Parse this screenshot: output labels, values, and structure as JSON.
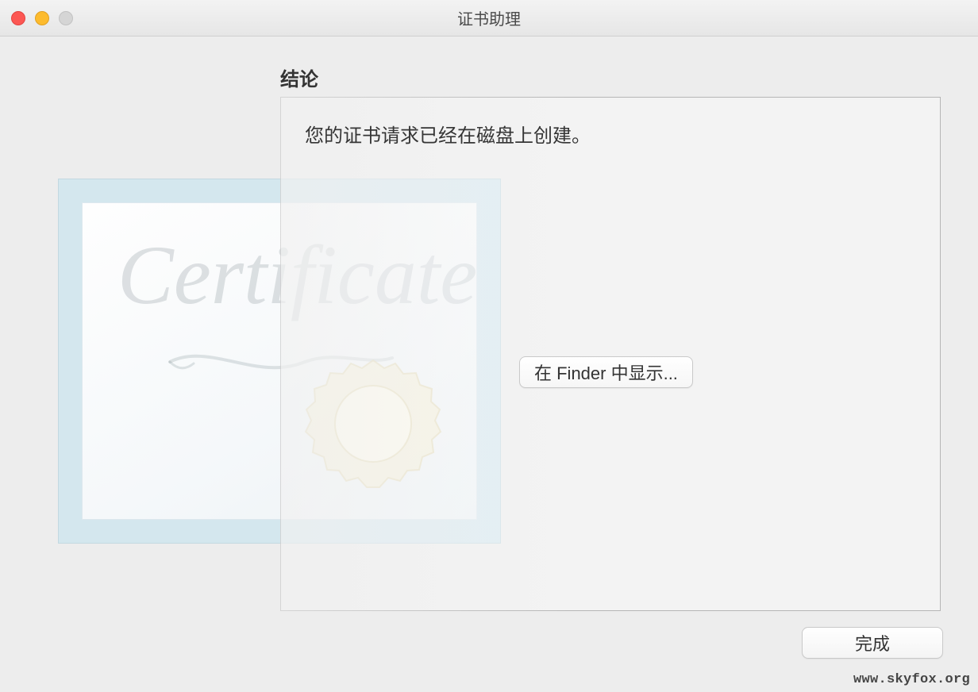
{
  "window": {
    "title": "证书助理"
  },
  "heading": "结论",
  "message": "您的证书请求已经在磁盘上创建。",
  "buttons": {
    "showInFinder": "在 Finder 中显示...",
    "done": "完成"
  },
  "graphic": {
    "cursiveText": "Certificate"
  },
  "watermark": "www.skyfox.org"
}
